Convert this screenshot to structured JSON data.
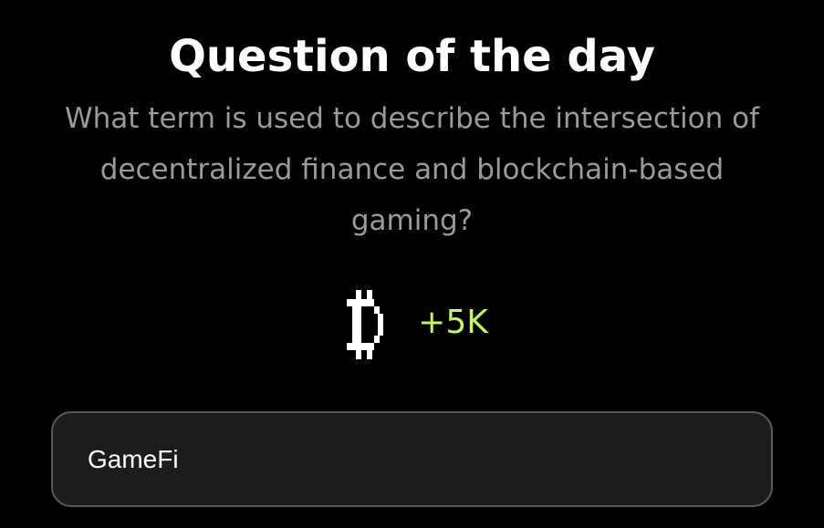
{
  "header": {
    "title": "Question of the day"
  },
  "quiz": {
    "question": "What term is used to describe the intersection of decentralized finance and blockchain-based gaming?",
    "reward": {
      "icon": "pixel-coin-icon",
      "amount": "+5K",
      "amount_color": "#c6f36f"
    },
    "answer": {
      "value": "GameFi"
    }
  }
}
